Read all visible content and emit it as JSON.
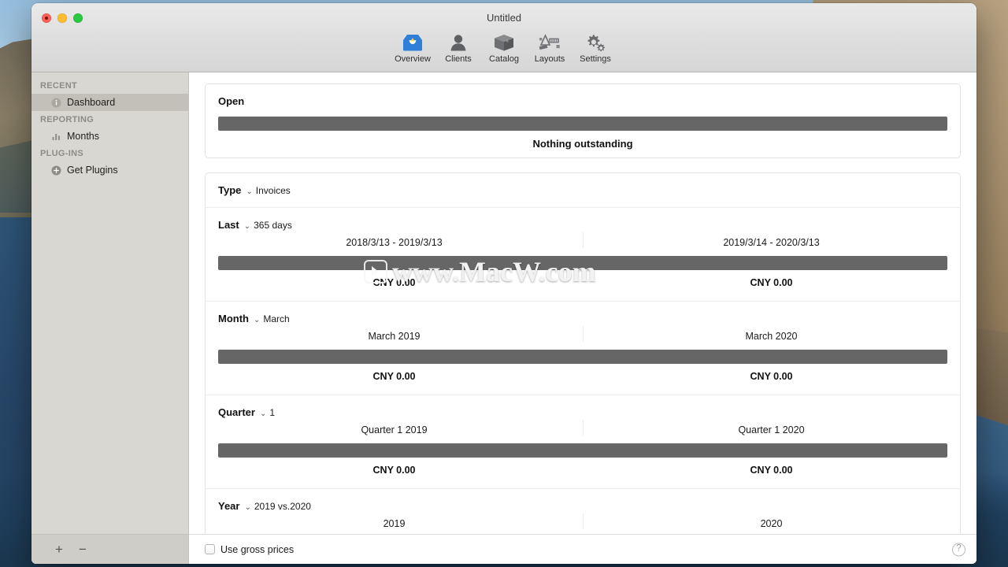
{
  "window": {
    "title": "Untitled",
    "traffic_lights": [
      "close-button",
      "minimize-button",
      "zoom-button"
    ]
  },
  "toolbar": {
    "items": [
      {
        "label": "Overview",
        "icon": "inbox-icon",
        "selected": true
      },
      {
        "label": "Clients",
        "icon": "person-icon",
        "selected": false
      },
      {
        "label": "Catalog",
        "icon": "box-icon",
        "selected": false
      },
      {
        "label": "Layouts",
        "icon": "ruler-icon",
        "selected": false
      },
      {
        "label": "Settings",
        "icon": "gears-icon",
        "selected": false
      }
    ]
  },
  "sidebar": {
    "groups": [
      {
        "header": "RECENT",
        "items": [
          {
            "label": "Dashboard",
            "icon": "info-icon",
            "selected": true
          }
        ]
      },
      {
        "header": "REPORTING",
        "items": [
          {
            "label": "Months",
            "icon": "bar-chart-icon",
            "selected": false
          }
        ]
      },
      {
        "header": "PLUG-INS",
        "items": [
          {
            "label": "Get Plugins",
            "icon": "plus-circle-icon",
            "selected": false
          }
        ]
      }
    ],
    "footer": {
      "add_label": "+",
      "remove_label": "−"
    }
  },
  "open_card": {
    "title": "Open",
    "note": "Nothing outstanding"
  },
  "filters": {
    "type": {
      "label": "Type",
      "value": "Invoices",
      "chevron": "⌄"
    },
    "rows": [
      {
        "label": "Last",
        "value": "365 days",
        "chevron": "⌄",
        "left": {
          "title": "2018/3/13 - 2019/3/13",
          "amount": "CNY 0.00"
        },
        "right": {
          "title": "2019/3/14 - 2020/3/13",
          "amount": "CNY 0.00"
        }
      },
      {
        "label": "Month",
        "value": "March",
        "chevron": "⌄",
        "left": {
          "title": "March 2019",
          "amount": "CNY 0.00"
        },
        "right": {
          "title": "March 2020",
          "amount": "CNY 0.00"
        }
      },
      {
        "label": "Quarter",
        "value": "1",
        "chevron": "⌄",
        "left": {
          "title": "Quarter 1 2019",
          "amount": "CNY 0.00"
        },
        "right": {
          "title": "Quarter 1 2020",
          "amount": "CNY 0.00"
        }
      },
      {
        "label": "Year",
        "value": "2019 vs.2020",
        "chevron": "⌄",
        "left": {
          "title": "2019",
          "amount": ""
        },
        "right": {
          "title": "2020",
          "amount": ""
        }
      }
    ]
  },
  "watermark": {
    "text": "www.MacW.com",
    "mark": "monitor-icon"
  },
  "footer": {
    "checkbox_label": "Use gross prices",
    "checked": false,
    "help_label": "?"
  },
  "colors": {
    "bar": "#666666",
    "sidebar_bg": "#d9d7d2",
    "selection": "#c3c0b9",
    "accent_blue": "#2f7fd8"
  }
}
